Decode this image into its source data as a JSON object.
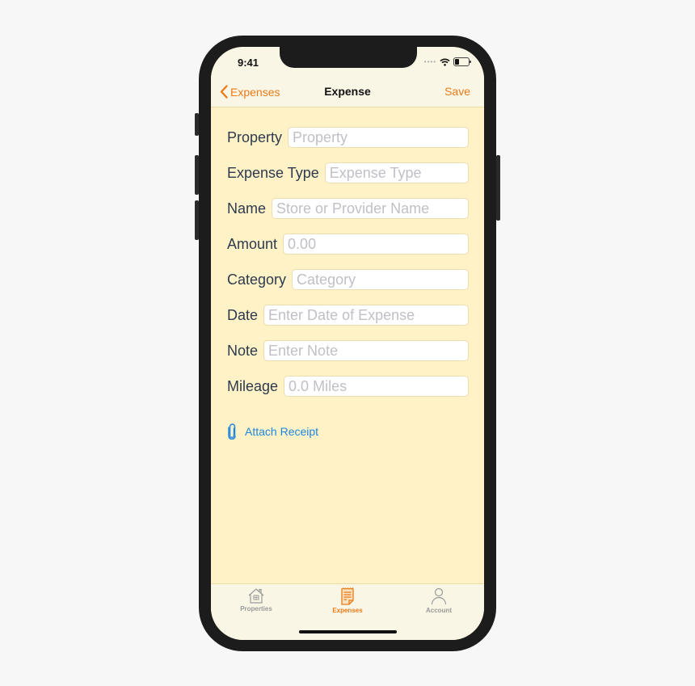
{
  "status_bar": {
    "time": "9:41"
  },
  "nav": {
    "back_label": "Expenses",
    "title": "Expense",
    "save_label": "Save"
  },
  "form": {
    "fields": [
      {
        "label": "Property",
        "placeholder": "Property",
        "value": ""
      },
      {
        "label": "Expense Type",
        "placeholder": "Expense Type",
        "value": ""
      },
      {
        "label": "Name",
        "placeholder": "Store or Provider Name",
        "value": ""
      },
      {
        "label": "Amount",
        "placeholder": "0.00",
        "value": ""
      },
      {
        "label": "Category",
        "placeholder": "Category",
        "value": ""
      },
      {
        "label": "Date",
        "placeholder": "Enter Date of Expense",
        "value": ""
      },
      {
        "label": "Note",
        "placeholder": "Enter Note",
        "value": ""
      },
      {
        "label": "Mileage",
        "placeholder": "0.0 Miles",
        "value": ""
      }
    ],
    "attach_label": "Attach Receipt"
  },
  "tabbar": {
    "tabs": [
      {
        "label": "Properties",
        "icon": "house-icon",
        "active": false
      },
      {
        "label": "Expenses",
        "icon": "receipt-icon",
        "active": true
      },
      {
        "label": "Account",
        "icon": "person-icon",
        "active": false
      }
    ]
  },
  "colors": {
    "accent": "#ea7a18",
    "link": "#1c86e0",
    "background": "#fff2c6",
    "bar": "#faf6e6"
  }
}
